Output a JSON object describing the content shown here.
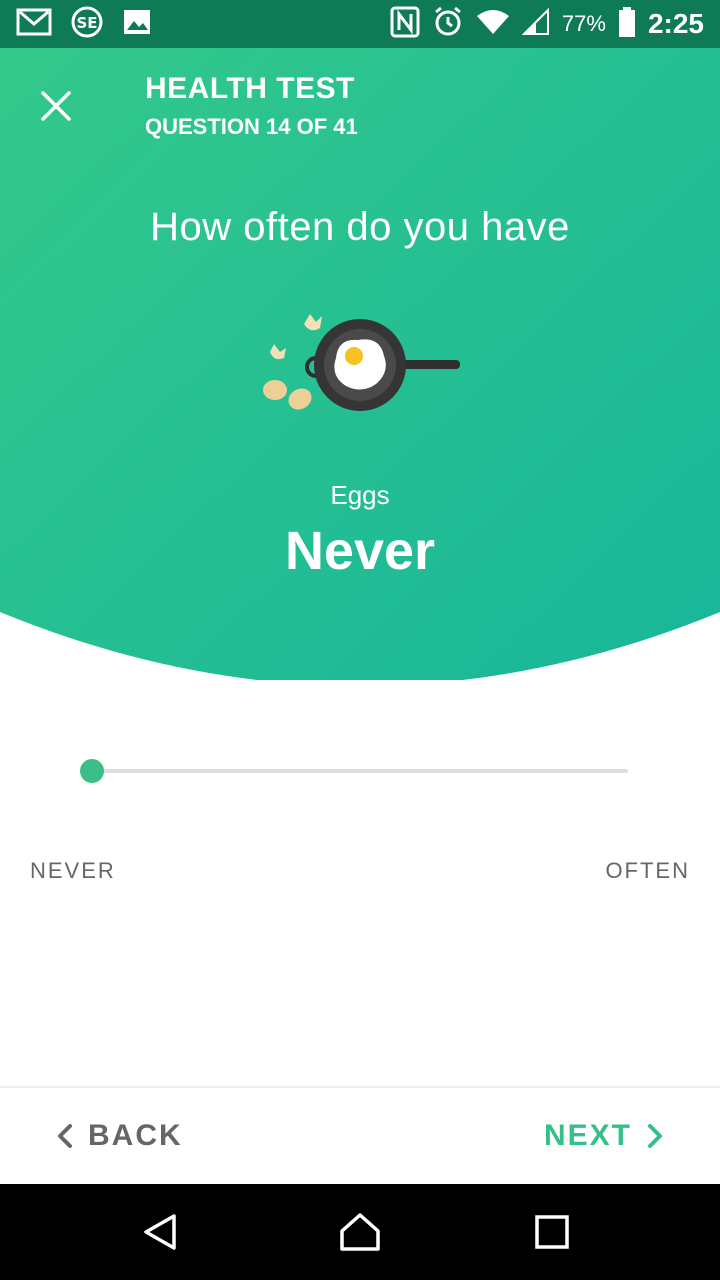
{
  "status_bar": {
    "battery": "77%",
    "time": "2:25",
    "icons_left": [
      "gmail-icon",
      "se-icon",
      "gallery-icon"
    ],
    "icons_right": [
      "nfc-icon",
      "alarm-icon",
      "wifi-icon",
      "signal-icon",
      "battery-icon"
    ]
  },
  "header": {
    "title": "HEALTH TEST",
    "subtitle": "QUESTION 14 OF 41"
  },
  "question": {
    "text": "How often do you have",
    "food": "Eggs",
    "answer": "Never",
    "illustration": "fried-egg-pan-icon"
  },
  "slider": {
    "min_label": "NEVER",
    "max_label": "OFTEN",
    "value": 0
  },
  "footer": {
    "back_label": "BACK",
    "next_label": "NEXT"
  },
  "colors": {
    "accent": "#35c08a",
    "header_start": "#34c88a",
    "header_end": "#1bb896"
  }
}
